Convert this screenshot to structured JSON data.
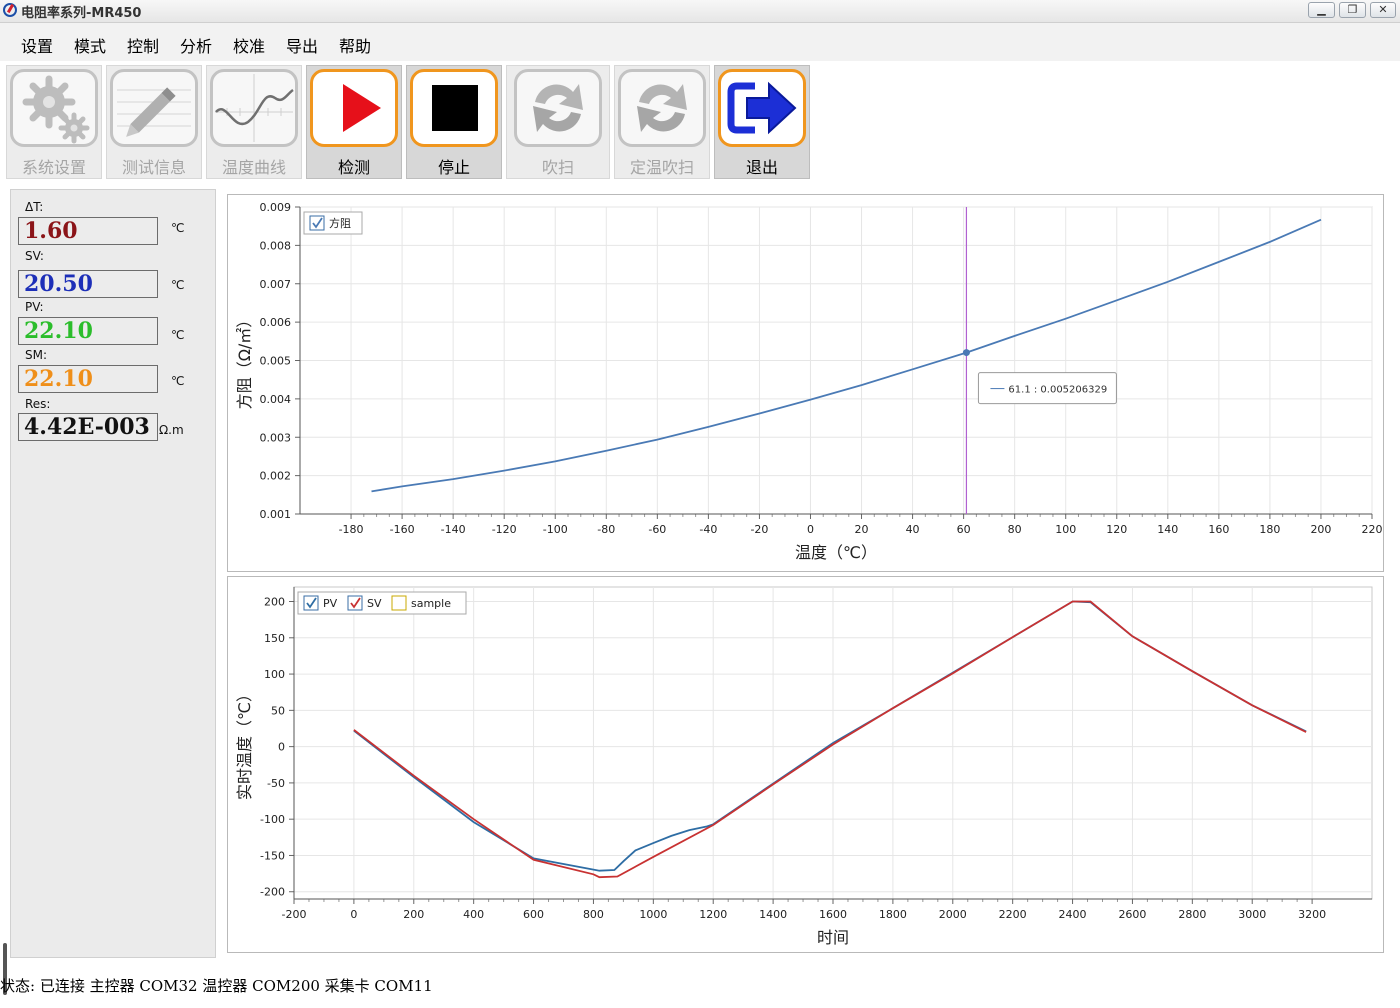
{
  "window": {
    "title": "电阻率系列-MR450",
    "controls": [
      "minimize",
      "restore",
      "close"
    ]
  },
  "menu": [
    "设置",
    "模式",
    "控制",
    "分析",
    "校准",
    "导出",
    "帮助"
  ],
  "toolbar": [
    {
      "label": "系统设置",
      "icon": "gears-icon",
      "enabled": false
    },
    {
      "label": "测试信息",
      "icon": "pencil-icon",
      "enabled": false
    },
    {
      "label": "温度曲线",
      "icon": "curve-icon",
      "enabled": false
    },
    {
      "label": "检测",
      "icon": "play-icon",
      "enabled": true
    },
    {
      "label": "停止",
      "icon": "stop-icon",
      "enabled": true
    },
    {
      "label": "吹扫",
      "icon": "refresh-icon",
      "enabled": false
    },
    {
      "label": "定温吹扫",
      "icon": "refresh-icon",
      "enabled": false
    },
    {
      "label": "退出",
      "icon": "exit-arrow-icon",
      "enabled": true
    }
  ],
  "readings": [
    {
      "label": "ΔT:",
      "value": "1.60",
      "unit": "℃",
      "color": "#8b1418"
    },
    {
      "label": "SV:",
      "value": "20.50",
      "unit": "℃",
      "color": "#1d2fb8"
    },
    {
      "label": "PV:",
      "value": "22.10",
      "unit": "℃",
      "color": "#2bbd2b"
    },
    {
      "label": "SM:",
      "value": "22.10",
      "unit": "℃",
      "color": "#ef8f1a"
    },
    {
      "label": "Res:",
      "value": "4.42E-003",
      "unit": "Ω.m",
      "color": "#111111"
    }
  ],
  "status": {
    "prefix": "状态:",
    "text": "已连接   主控器 COM32 温控器 COM200 采集卡 COM11"
  },
  "chart_data": [
    {
      "type": "line",
      "xlabel": "温度（℃）",
      "ylabel": "方阻（Ω/㎡）",
      "xlim": [
        -200,
        220
      ],
      "ylim": [
        0.001,
        0.009
      ],
      "xticks": [
        -180,
        -160,
        -140,
        -120,
        -100,
        -80,
        -60,
        -40,
        -20,
        0,
        20,
        40,
        60,
        80,
        100,
        120,
        140,
        160,
        180,
        200,
        220
      ],
      "yticks": [
        0.001,
        0.002,
        0.003,
        0.004,
        0.005,
        0.006,
        0.007,
        0.008,
        0.009
      ],
      "ytick_labels": [
        "0.001",
        "0.002",
        "0.003",
        "0.004",
        "0.005",
        "0.006",
        "0.007",
        "0.008",
        "0.009"
      ],
      "grid": true,
      "legend_position": "top-left",
      "series": [
        {
          "name": "方阻",
          "color": "#4a7ab5",
          "checked": true,
          "x": [
            -172,
            -160,
            -140,
            -120,
            -100,
            -80,
            -60,
            -40,
            -20,
            0,
            20,
            40,
            61.1,
            80,
            100,
            120,
            140,
            160,
            180,
            200
          ],
          "y": [
            0.00159,
            0.00172,
            0.00191,
            0.00213,
            0.00237,
            0.00265,
            0.00294,
            0.00327,
            0.00362,
            0.00398,
            0.00436,
            0.00477,
            0.005206329,
            0.00564,
            0.00609,
            0.00657,
            0.00705,
            0.00757,
            0.00809,
            0.00867
          ]
        }
      ],
      "cursor": {
        "x": 61.1,
        "y": 0.005206329,
        "label": "61.1 : 0.005206329",
        "color": "#b060d0"
      }
    },
    {
      "type": "line",
      "xlabel": "时间",
      "ylabel": "实时温度（℃）",
      "xlim": [
        -200,
        3400
      ],
      "ylim": [
        -210,
        220
      ],
      "xticks": [
        -200,
        0,
        200,
        400,
        600,
        800,
        1000,
        1200,
        1400,
        1600,
        1800,
        2000,
        2200,
        2400,
        2600,
        2800,
        3000,
        3200
      ],
      "yticks": [
        200,
        150,
        100,
        50,
        0,
        -50,
        -100,
        -150,
        -200
      ],
      "grid": true,
      "legend_position": "top-left",
      "series": [
        {
          "name": "PV",
          "color": "#2e6da4",
          "checked": true,
          "x": [
            0,
            200,
            400,
            600,
            780,
            820,
            870,
            900,
            940,
            1000,
            1060,
            1120,
            1180,
            1200,
            1400,
            1600,
            1800,
            2000,
            2200,
            2400,
            2460,
            2600,
            2800,
            3000,
            3180
          ],
          "y": [
            22,
            -42,
            -104,
            -154,
            -168,
            -171,
            -170,
            -158,
            -143,
            -133,
            -123,
            -115,
            -110,
            -107,
            -51,
            5,
            53,
            102,
            151,
            200,
            199,
            152,
            104,
            57,
            21
          ]
        },
        {
          "name": "SV",
          "color": "#c83232",
          "checked": true,
          "x": [
            0,
            200,
            400,
            600,
            800,
            820,
            880,
            1000,
            1200,
            1400,
            1600,
            1800,
            2000,
            2200,
            2400,
            2460,
            2600,
            2800,
            3000,
            3180
          ],
          "y": [
            23,
            -40,
            -100,
            -156,
            -176,
            -180,
            -179,
            -152,
            -108,
            -52,
            3,
            53,
            101,
            151,
            200,
            200,
            152,
            104,
            57,
            20
          ]
        },
        {
          "name": "sample",
          "color": "#c9a800",
          "checked": false,
          "x": [],
          "y": []
        }
      ]
    }
  ]
}
